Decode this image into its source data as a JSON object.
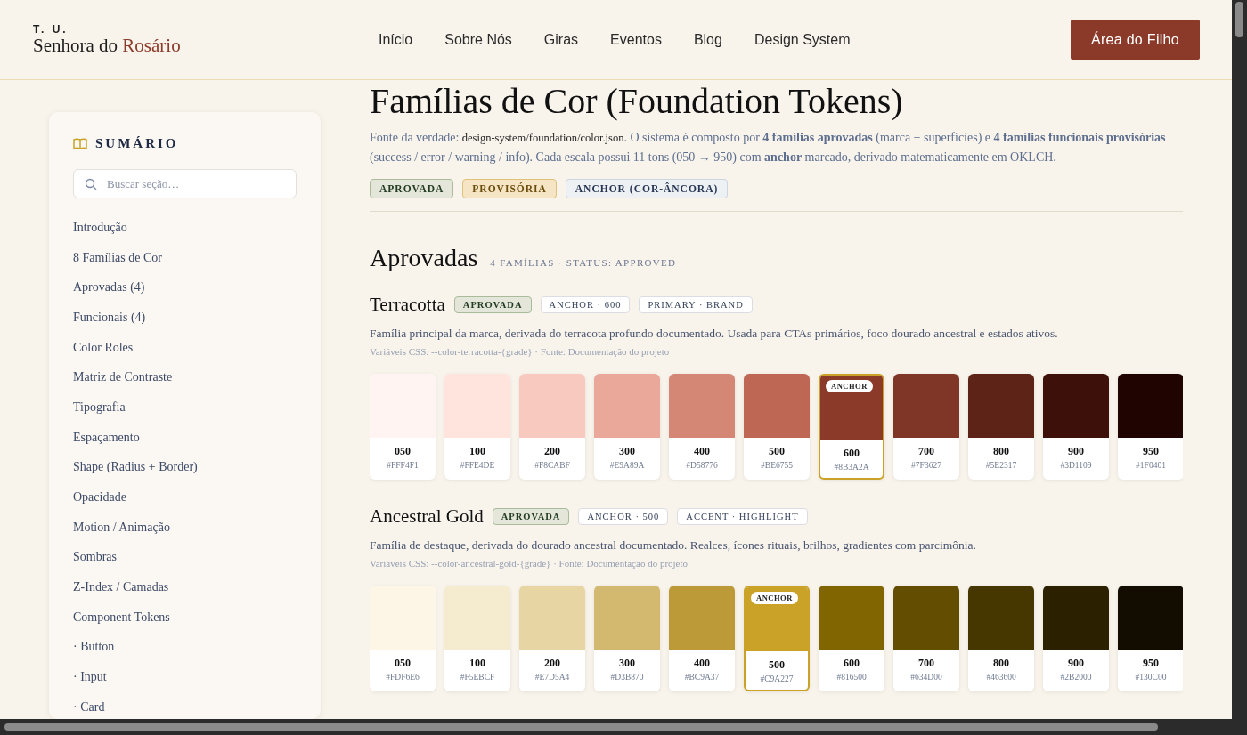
{
  "header": {
    "logo_small": "T. U.",
    "logo_main": "Senhora do",
    "logo_accent": "Rosário",
    "nav": [
      "Início",
      "Sobre Nós",
      "Giras",
      "Eventos",
      "Blog",
      "Design System"
    ],
    "cta": "Área do Filho"
  },
  "sidebar": {
    "title": "SUMÁRIO",
    "search": {
      "placeholder": "Buscar seção…"
    },
    "items": [
      "Introdução",
      "8 Famílias de Cor",
      "Aprovadas (4)",
      "Funcionais (4)",
      "Color Roles",
      "Matriz de Contraste",
      "Tipografia",
      "Espaçamento",
      "Shape (Radius + Border)",
      "Opacidade",
      "Motion / Animação",
      "Sombras",
      "Z-Index / Camadas",
      "Component Tokens",
      "· Button",
      "· Input",
      "· Card"
    ]
  },
  "intro": {
    "title": "Famílias de Cor (Foundation Tokens)",
    "text_before": "Fonte da verdade: ",
    "source_path": "design-system/foundation/color.json",
    "text_after": ". O sistema é composto por **4 famílias aprovadas** (marca + superfícies) e **4 famílias funcionais provisórias** (success / error / warning / info). Cada escala possui 11 tons (050 → 950) com **anchor** marcado, derivado matematicamente em OKLCH.",
    "legend": [
      {
        "label": "APROVADA",
        "kind": "approved"
      },
      {
        "label": "PROVISÓRIA",
        "kind": "provisional"
      },
      {
        "label": "ANCHOR (COR-ÂNCORA)",
        "kind": "anchor"
      }
    ]
  },
  "section": {
    "title": "Aprovadas",
    "meta": "4 FAMÍLIAS · STATUS: APPROVED"
  },
  "families": [
    {
      "name": "Terracotta",
      "status": {
        "label": "APROVADA",
        "kind": "approved"
      },
      "tags": [
        "ANCHOR · 600",
        "PRIMARY · BRAND"
      ],
      "description": "Família principal da marca, derivada do terracota profundo documentado. Usada para CTAs primários, foco dourado ancestral e estados ativos.",
      "vars": "Variáveis CSS: --color-terracotta-{grade} · Fonte: Documentação do projeto",
      "swatches": [
        {
          "grade": "050",
          "hex": "#FFF4F1",
          "color": "#fff4f1",
          "anchor": false
        },
        {
          "grade": "100",
          "hex": "#FFE4DE",
          "color": "#ffe4de",
          "anchor": false
        },
        {
          "grade": "200",
          "hex": "#F8CABF",
          "color": "#f8cabf",
          "anchor": false
        },
        {
          "grade": "300",
          "hex": "#E9A89A",
          "color": "#e9a89a",
          "anchor": false
        },
        {
          "grade": "400",
          "hex": "#D58776",
          "color": "#d58776",
          "anchor": false
        },
        {
          "grade": "500",
          "hex": "#BE6755",
          "color": "#be6755",
          "anchor": false
        },
        {
          "grade": "600",
          "hex": "#8B3A2A",
          "color": "#8b3a2a",
          "anchor": true,
          "badge": "ANCHOR"
        },
        {
          "grade": "700",
          "hex": "#7F3627",
          "color": "#7f3627",
          "anchor": false
        },
        {
          "grade": "800",
          "hex": "#5E2317",
          "color": "#5e2317",
          "anchor": false
        },
        {
          "grade": "900",
          "hex": "#3D1109",
          "color": "#3d1109",
          "anchor": false
        },
        {
          "grade": "950",
          "hex": "#1F0401",
          "color": "#1f0401",
          "anchor": false
        }
      ]
    },
    {
      "name": "Ancestral Gold",
      "status": {
        "label": "APROVADA",
        "kind": "approved"
      },
      "tags": [
        "ANCHOR · 500",
        "ACCENT · HIGHLIGHT"
      ],
      "description": "Família de destaque, derivada do dourado ancestral documentado. Realces, ícones rituais, brilhos, gradientes com parcimônia.",
      "vars": "Variáveis CSS: --color-ancestral-gold-{grade} · Fonte: Documentação do projeto",
      "swatches": [
        {
          "grade": "050",
          "hex": "#FDF6E6",
          "color": "#fdf6e6",
          "anchor": false
        },
        {
          "grade": "100",
          "hex": "#F5EBCF",
          "color": "#f5ebcf",
          "anchor": false
        },
        {
          "grade": "200",
          "hex": "#E7D5A4",
          "color": "#e7d5a4",
          "anchor": false
        },
        {
          "grade": "300",
          "hex": "#D3B870",
          "color": "#d3b870",
          "anchor": false
        },
        {
          "grade": "400",
          "hex": "#BC9A37",
          "color": "#bc9a37",
          "anchor": false
        },
        {
          "grade": "500",
          "hex": "#C9A227",
          "color": "#c9a227",
          "anchor": true,
          "badge": "ANCHOR"
        },
        {
          "grade": "600",
          "hex": "#816500",
          "color": "#816500",
          "anchor": false
        },
        {
          "grade": "700",
          "hex": "#634D00",
          "color": "#634d00",
          "anchor": false
        },
        {
          "grade": "800",
          "hex": "#463600",
          "color": "#463600",
          "anchor": false
        },
        {
          "grade": "900",
          "hex": "#2B2000",
          "color": "#2b2000",
          "anchor": false
        },
        {
          "grade": "950",
          "hex": "#130C00",
          "color": "#130c00",
          "anchor": false
        }
      ]
    }
  ]
}
